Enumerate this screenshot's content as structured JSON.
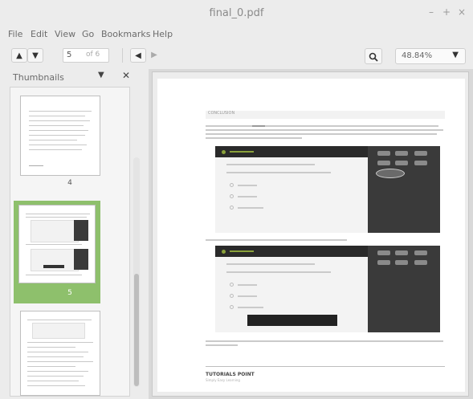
{
  "window": {
    "title": "final_0.pdf"
  },
  "menu": {
    "items": [
      "File",
      "Edit",
      "View",
      "Go",
      "Bookmarks",
      "Help"
    ]
  },
  "toolbar": {
    "page_current": "5",
    "page_of": "of 6",
    "zoom": "48.84%"
  },
  "sidebar": {
    "title": "Thumbnails",
    "thumb_labels": [
      "4",
      "5",
      ""
    ]
  },
  "document": {
    "section_label": "CONCLUSION",
    "footer_brand": "TUTORIALS POINT",
    "footer_tagline": "Simply Easy Learning"
  },
  "colors": {
    "selection": "#8ec06c",
    "accent": "#8aa13a"
  }
}
